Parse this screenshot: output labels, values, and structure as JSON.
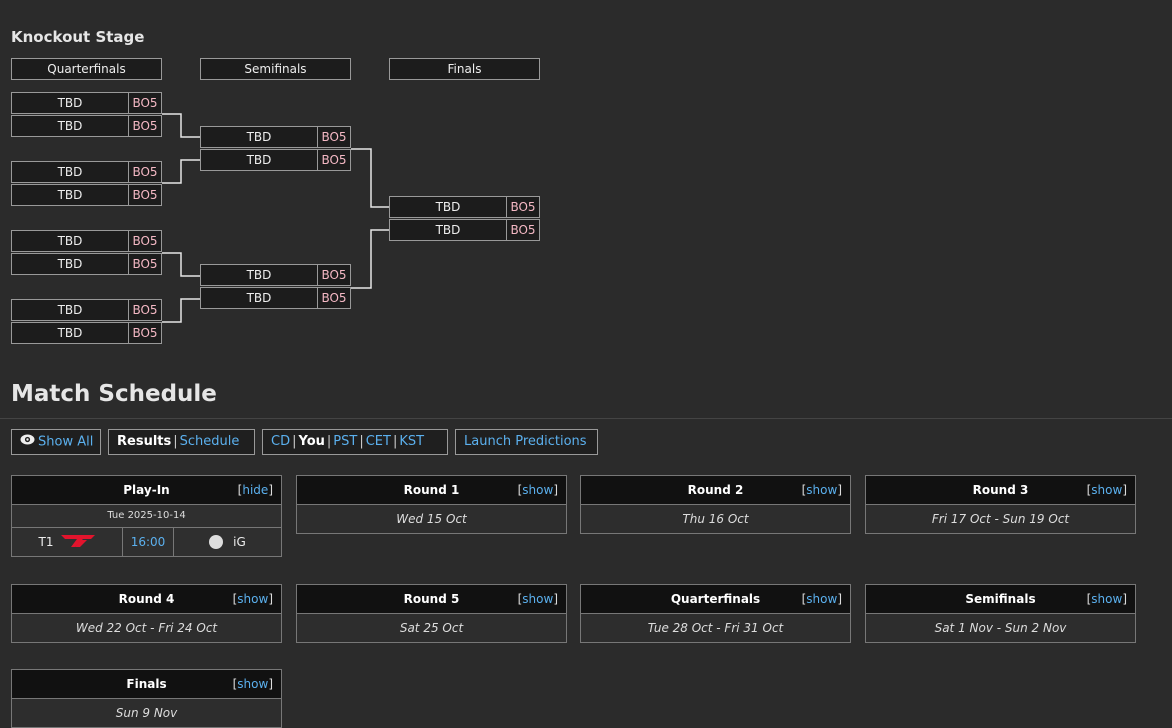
{
  "knockout": {
    "title": "Knockout Stage",
    "stages": [
      "Quarterfinals",
      "Semifinals",
      "Finals"
    ],
    "quarterfinals": [
      {
        "team": "TBD",
        "bo": "BO5"
      },
      {
        "team": "TBD",
        "bo": "BO5"
      },
      {
        "team": "TBD",
        "bo": "BO5"
      },
      {
        "team": "TBD",
        "bo": "BO5"
      },
      {
        "team": "TBD",
        "bo": "BO5"
      },
      {
        "team": "TBD",
        "bo": "BO5"
      },
      {
        "team": "TBD",
        "bo": "BO5"
      },
      {
        "team": "TBD",
        "bo": "BO5"
      }
    ],
    "semifinals": [
      {
        "team": "TBD",
        "bo": "BO5"
      },
      {
        "team": "TBD",
        "bo": "BO5"
      },
      {
        "team": "TBD",
        "bo": "BO5"
      },
      {
        "team": "TBD",
        "bo": "BO5"
      }
    ],
    "finals": [
      {
        "team": "TBD",
        "bo": "BO5"
      },
      {
        "team": "TBD",
        "bo": "BO5"
      }
    ]
  },
  "schedule": {
    "title": "Match Schedule",
    "show_all": "Show All",
    "results": "Results",
    "schedule_link": "Schedule",
    "sep": "|",
    "tz": [
      "CD",
      "You",
      "PST",
      "CET",
      "KST"
    ],
    "predictions": "Launch Predictions",
    "cards": [
      {
        "title": "Play-In",
        "toggle": "hide",
        "date": ""
      },
      {
        "title": "Round 1",
        "toggle": "show",
        "date": "Wed 15 Oct"
      },
      {
        "title": "Round 2",
        "toggle": "show",
        "date": "Thu 16 Oct"
      },
      {
        "title": "Round 3",
        "toggle": "show",
        "date": "Fri 17 Oct - Sun 19 Oct"
      },
      {
        "title": "Round 4",
        "toggle": "show",
        "date": "Wed 22 Oct - Fri 24 Oct"
      },
      {
        "title": "Round 5",
        "toggle": "show",
        "date": "Sat 25 Oct"
      },
      {
        "title": "Quarterfinals",
        "toggle": "show",
        "date": "Tue 28 Oct - Fri 31 Oct"
      },
      {
        "title": "Semifinals",
        "toggle": "show",
        "date": "Sat 1 Nov - Sun 2 Nov"
      },
      {
        "title": "Finals",
        "toggle": "show",
        "date": "Sun 9 Nov"
      }
    ],
    "playin_match": {
      "date": "Tue 2025-10-14",
      "team1": "T1",
      "time": "16:00",
      "team2": "iG"
    }
  }
}
